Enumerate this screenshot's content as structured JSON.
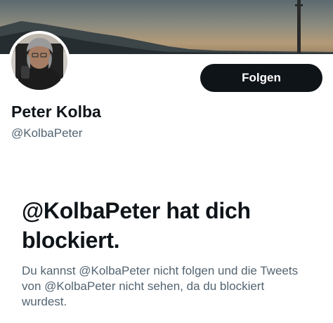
{
  "profile": {
    "display_name": "Peter Kolba",
    "handle": "@KolbaPeter",
    "follow_label": "Folgen"
  },
  "blocked_notice": {
    "title": "@KolbaPeter hat dich blockiert.",
    "text": "Du kannst @KolbaPeter nicht folgen und die Tweets von @KolbaPeter nicht sehen, da du blockiert wurdest."
  },
  "colors": {
    "button_bg": "#0f1419",
    "primary_text": "#0f1419",
    "secondary_text": "#536471"
  },
  "icons": {
    "banner": "landscape-photo",
    "avatar": "profile-photo"
  }
}
